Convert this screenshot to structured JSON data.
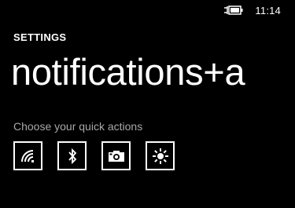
{
  "status_bar": {
    "battery_icon": "battery-charging-icon",
    "time": "11:14"
  },
  "header": {
    "section": "SETTINGS",
    "title": "notifications+a"
  },
  "quick_actions": {
    "label": "Choose your quick actions",
    "items": [
      {
        "icon": "wifi-icon"
      },
      {
        "icon": "bluetooth-icon"
      },
      {
        "icon": "camera-icon"
      },
      {
        "icon": "brightness-icon"
      }
    ]
  },
  "colors": {
    "background": "#000000",
    "foreground": "#ffffff",
    "secondary_text": "#a8a8a8"
  }
}
